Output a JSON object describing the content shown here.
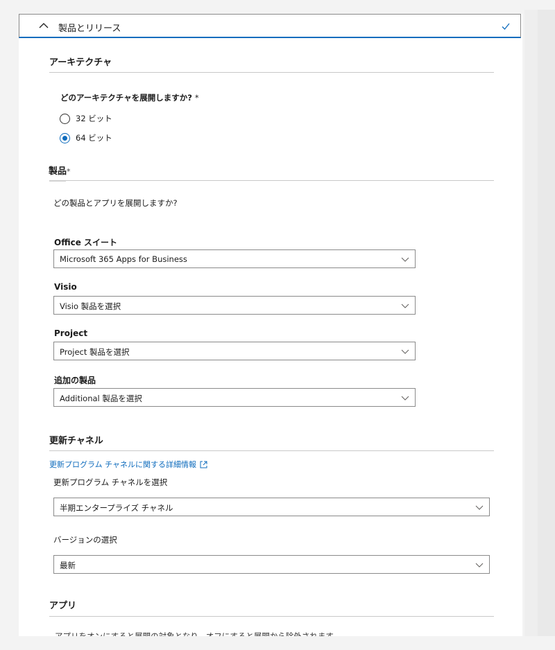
{
  "accordion": {
    "title": "製品とリリース"
  },
  "architecture": {
    "section_title": "アーキテクチャ",
    "question": "どのアーキテクチャを展開しますか?",
    "required_mark": "*",
    "options": [
      {
        "label": "32 ビット",
        "checked": false
      },
      {
        "label": "64 ビット",
        "checked": true
      }
    ]
  },
  "products": {
    "section_title": "製品",
    "required_mark": "*",
    "description": "どの製品とアプリを展開しますか?",
    "office": {
      "label": "Office スイート",
      "value": "Microsoft 365 Apps for Business"
    },
    "visio": {
      "label": "Visio",
      "value": "Visio 製品を選択"
    },
    "project": {
      "label": "Project",
      "value": "Project 製品を選択"
    },
    "additional": {
      "label": "追加の製品",
      "value": "Additional 製品を選択"
    }
  },
  "update_channel": {
    "section_title": "更新チャネル",
    "link_text": "更新プログラム チャネルに関する詳細情報",
    "channel_label": "更新プログラム チャネルを選択",
    "channel_value": "半期エンタープライズ チャネル",
    "version_label": "バージョンの選択",
    "version_value": "最新"
  },
  "apps": {
    "section_title": "アプリ",
    "description_partial": "アプリをオンにすると展開の対象となり、オフにすると展開から除外されます。"
  },
  "icons": {
    "collapse": "chevron-up-icon",
    "complete": "checkmark-icon",
    "dropdown": "chevron-down-icon",
    "external": "open-in-new-window-icon"
  },
  "colors": {
    "accent": "#0f6cbd",
    "border": "#8a8a8a",
    "divider": "#c8c8c8"
  }
}
